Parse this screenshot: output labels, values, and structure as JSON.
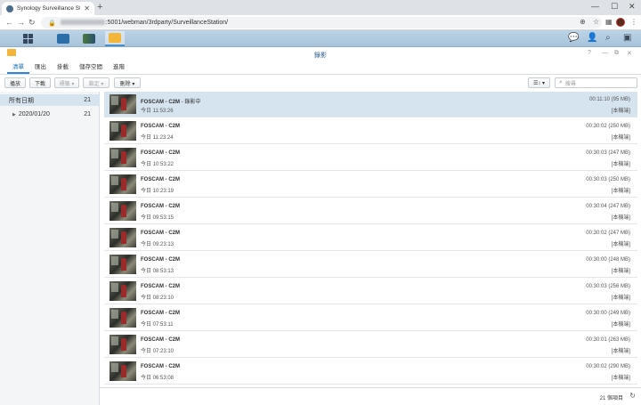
{
  "browser": {
    "tab_title": "Synology Surveillance Statio",
    "url_visible": ":5001/webman/3rdparty/SurveillanceStation/"
  },
  "window": {
    "title": "錄影",
    "tabs": [
      "清單",
      "匯出",
      "掛載",
      "儲存空間",
      "進階"
    ],
    "active_tab": "清單"
  },
  "toolbar": {
    "play": "播放",
    "download": "下載",
    "tag": "標籤 ▾",
    "lock": "鎖定 ▾",
    "delete": "刪除 ▾",
    "search_placeholder": "搜尋"
  },
  "left_pane": {
    "all_dates_label": "所有日期",
    "all_dates_count": "21",
    "date_label": "2020/01/20",
    "date_count": "21"
  },
  "recordings": [
    {
      "name": "FOSCAM - C2M",
      "status": " - 錄影中",
      "time": "今日 11:53:26",
      "duration": "00:11:10 (95 MB)",
      "location": "[本機端]"
    },
    {
      "name": "FOSCAM - C2M",
      "status": "",
      "time": "今日 11:23:24",
      "duration": "00:30:02 (250 MB)",
      "location": "[本機端]"
    },
    {
      "name": "FOSCAM - C2M",
      "status": "",
      "time": "今日 10:53:22",
      "duration": "00:30:03 (247 MB)",
      "location": "[本機端]"
    },
    {
      "name": "FOSCAM - C2M",
      "status": "",
      "time": "今日 10:23:19",
      "duration": "00:30:03 (250 MB)",
      "location": "[本機端]"
    },
    {
      "name": "FOSCAM - C2M",
      "status": "",
      "time": "今日 09:53:15",
      "duration": "00:30:04 (247 MB)",
      "location": "[本機端]"
    },
    {
      "name": "FOSCAM - C2M",
      "status": "",
      "time": "今日 09:23:13",
      "duration": "00:30:02 (247 MB)",
      "location": "[本機端]"
    },
    {
      "name": "FOSCAM - C2M",
      "status": "",
      "time": "今日 08:53:13",
      "duration": "00:30:00 (248 MB)",
      "location": "[本機端]"
    },
    {
      "name": "FOSCAM - C2M",
      "status": "",
      "time": "今日 08:23:10",
      "duration": "00:30:03 (256 MB)",
      "location": "[本機端]"
    },
    {
      "name": "FOSCAM - C2M",
      "status": "",
      "time": "今日 07:53:11",
      "duration": "00:30:00 (249 MB)",
      "location": "[本機端]"
    },
    {
      "name": "FOSCAM - C2M",
      "status": "",
      "time": "今日 07:23:10",
      "duration": "00:30:01 (263 MB)",
      "location": "[本機端]"
    },
    {
      "name": "FOSCAM - C2M",
      "status": "",
      "time": "今日 06:53:08",
      "duration": "00:30:02 (290 MB)",
      "location": "[本機端]"
    }
  ],
  "footer": {
    "count": "21 個項目"
  },
  "colors": {
    "accent": "#2f86d3",
    "selected_row": "#d6e4ef",
    "taskbar": "#bcd3e6"
  }
}
